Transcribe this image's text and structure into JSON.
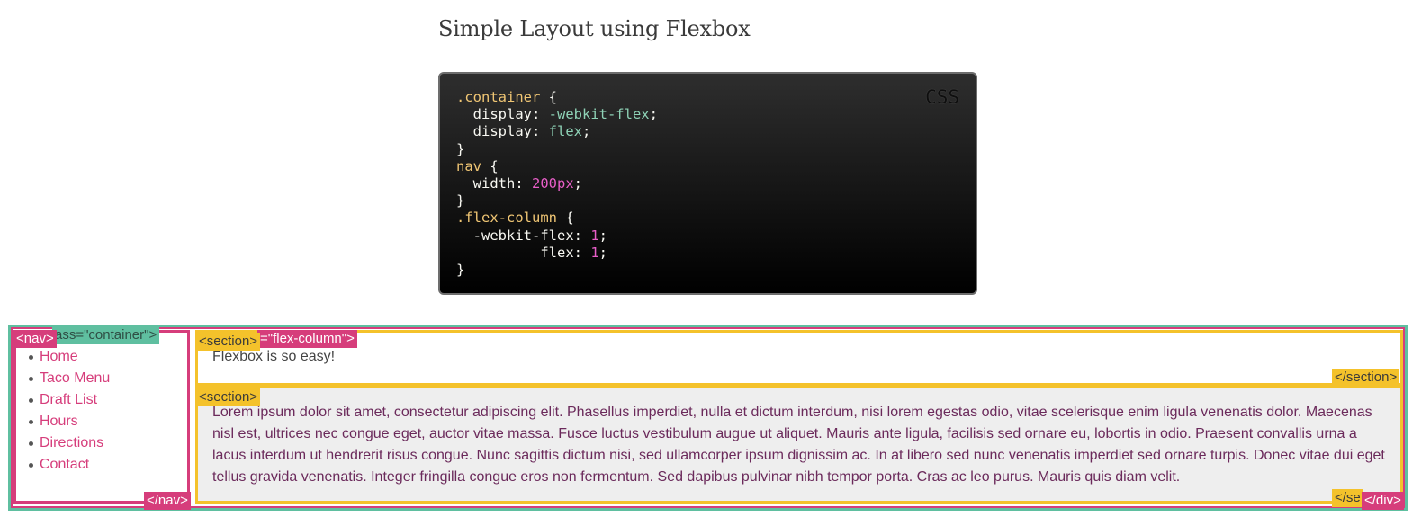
{
  "title": "Simple Layout using Flexbox",
  "code": {
    "lang": "CSS",
    "lines": [
      [
        {
          "t": ".container",
          "c": "sel"
        },
        {
          "t": " {",
          "c": ""
        }
      ],
      [
        {
          "t": "  display: ",
          "c": ""
        },
        {
          "t": "-webkit-flex",
          "c": "kw"
        },
        {
          "t": ";",
          "c": ""
        }
      ],
      [
        {
          "t": "  display: ",
          "c": ""
        },
        {
          "t": "flex",
          "c": "kw"
        },
        {
          "t": ";",
          "c": ""
        }
      ],
      [
        {
          "t": "}",
          "c": ""
        }
      ],
      [
        {
          "t": "nav",
          "c": "sel"
        },
        {
          "t": " {",
          "c": ""
        }
      ],
      [
        {
          "t": "  width: ",
          "c": ""
        },
        {
          "t": "200px",
          "c": "num"
        },
        {
          "t": ";",
          "c": ""
        }
      ],
      [
        {
          "t": "}",
          "c": ""
        }
      ],
      [
        {
          "t": ".flex-column",
          "c": "sel"
        },
        {
          "t": " {",
          "c": ""
        }
      ],
      [
        {
          "t": "  -webkit-flex: ",
          "c": ""
        },
        {
          "t": "1",
          "c": "num"
        },
        {
          "t": ";",
          "c": ""
        }
      ],
      [
        {
          "t": "          flex: ",
          "c": ""
        },
        {
          "t": "1",
          "c": "num"
        },
        {
          "t": ";",
          "c": ""
        }
      ],
      [
        {
          "t": "}",
          "c": ""
        }
      ]
    ]
  },
  "demo": {
    "tags": {
      "container_open": "ass=\"container\">",
      "nav_open": "<nav>",
      "nav_close": "</nav>",
      "section_open": "<section>",
      "section_close": "</section>",
      "flex_column": "=\"flex-column\">",
      "section_close_partial": "</se",
      "div_close": "</div>"
    },
    "nav_items": [
      "Home",
      "Taco Menu",
      "Draft List",
      "Hours",
      "Directions",
      "Contact"
    ],
    "section1_text": "Flexbox is so easy!",
    "section2_text": "Lorem ipsum dolor sit amet, consectetur adipiscing elit. Phasellus imperdiet, nulla et dictum interdum, nisi lorem egestas odio, vitae scelerisque enim ligula venenatis dolor. Maecenas nisl est, ultrices nec congue eget, auctor vitae massa. Fusce luctus vestibulum augue ut aliquet. Mauris ante ligula, facilisis sed ornare eu, lobortis in odio. Praesent convallis urna a lacus interdum ut hendrerit risus congue. Nunc sagittis dictum nisi, sed ullamcorper ipsum dignissim ac. In at libero sed nunc venenatis imperdiet sed ornare turpis. Donec vitae dui eget tellus gravida venenatis. Integer fringilla congue eros non fermentum. Sed dapibus pulvinar nibh tempor porta. Cras ac leo purus. Mauris quis diam velit."
  },
  "colors": {
    "accent_magenta": "#d63d7b",
    "accent_yellow": "#f4c22b",
    "accent_teal": "#5fbfa0"
  }
}
